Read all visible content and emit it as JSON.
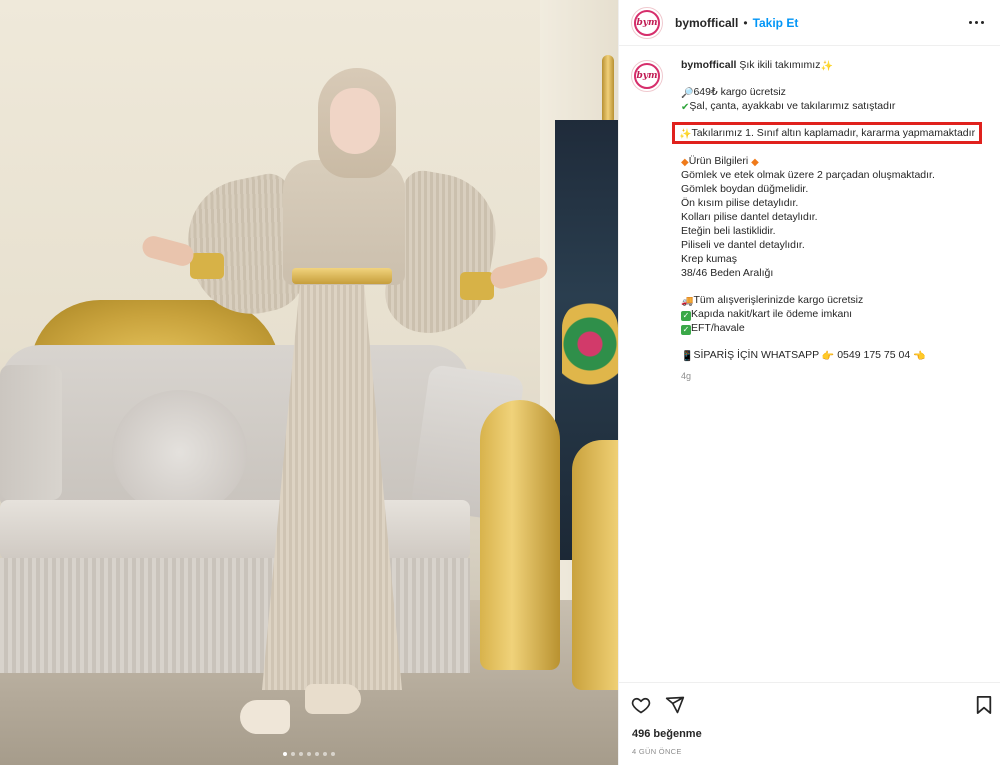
{
  "post": {
    "username": "bymofficall",
    "follow_label": "Takip Et",
    "separator": "•",
    "avatar_text": "bym",
    "image_dots": 7,
    "active_dot": 0
  },
  "caption": {
    "username": "bymofficall",
    "title": "Şık ikili takımımız",
    "lines": {
      "price": "649₺ kargo ücretsiz",
      "includes": "Şal, çanta, ayakkabı ve takılarımız satıştadır",
      "jewelry": "Takılarımız 1. Sınıf altın kaplamadır, kararma yapmamaktadır",
      "info_title": "Ürün Bilgileri",
      "d1": "Gömlek ve etek olmak üzere 2 parçadan oluşmaktadır.",
      "d2": "Gömlek boydan düğmelidir.",
      "d3": "Ön kısım pilise detaylıdır.",
      "d4": "Kolları pilise dantel detaylıdır.",
      "d5": "Eteğin beli lastiklidir.",
      "d6": "Piliseli ve dantel detaylıdır.",
      "d7": "Krep kumaş",
      "d8": "38/46 Beden Aralığı",
      "shipping": "Tüm alışverişlerinizde kargo ücretsiz",
      "payment1": "Kapıda nakit/kart ile ödeme imkanı",
      "payment2": "EFT/havale",
      "whatsapp": "SİPARİŞ İÇİN WHATSAPP",
      "phone": "0549 175 75 04"
    },
    "time_ago": "4g"
  },
  "footer": {
    "likes": "496 beğenme",
    "date": "4 GÜN ÖNCE"
  },
  "icons": [
    "more-icon",
    "heart-icon",
    "share-icon",
    "bookmark-icon",
    "magnifier-emoji-icon",
    "check-icon",
    "sparkles-icon",
    "diamond-icon",
    "phone-icon",
    "pointing-hand-icon",
    "delivery-truck-icon"
  ],
  "colors": {
    "accent_blue": "#0095f6",
    "highlight_red": "#e0211d",
    "text": "#262626",
    "muted": "#8e8e8e"
  }
}
